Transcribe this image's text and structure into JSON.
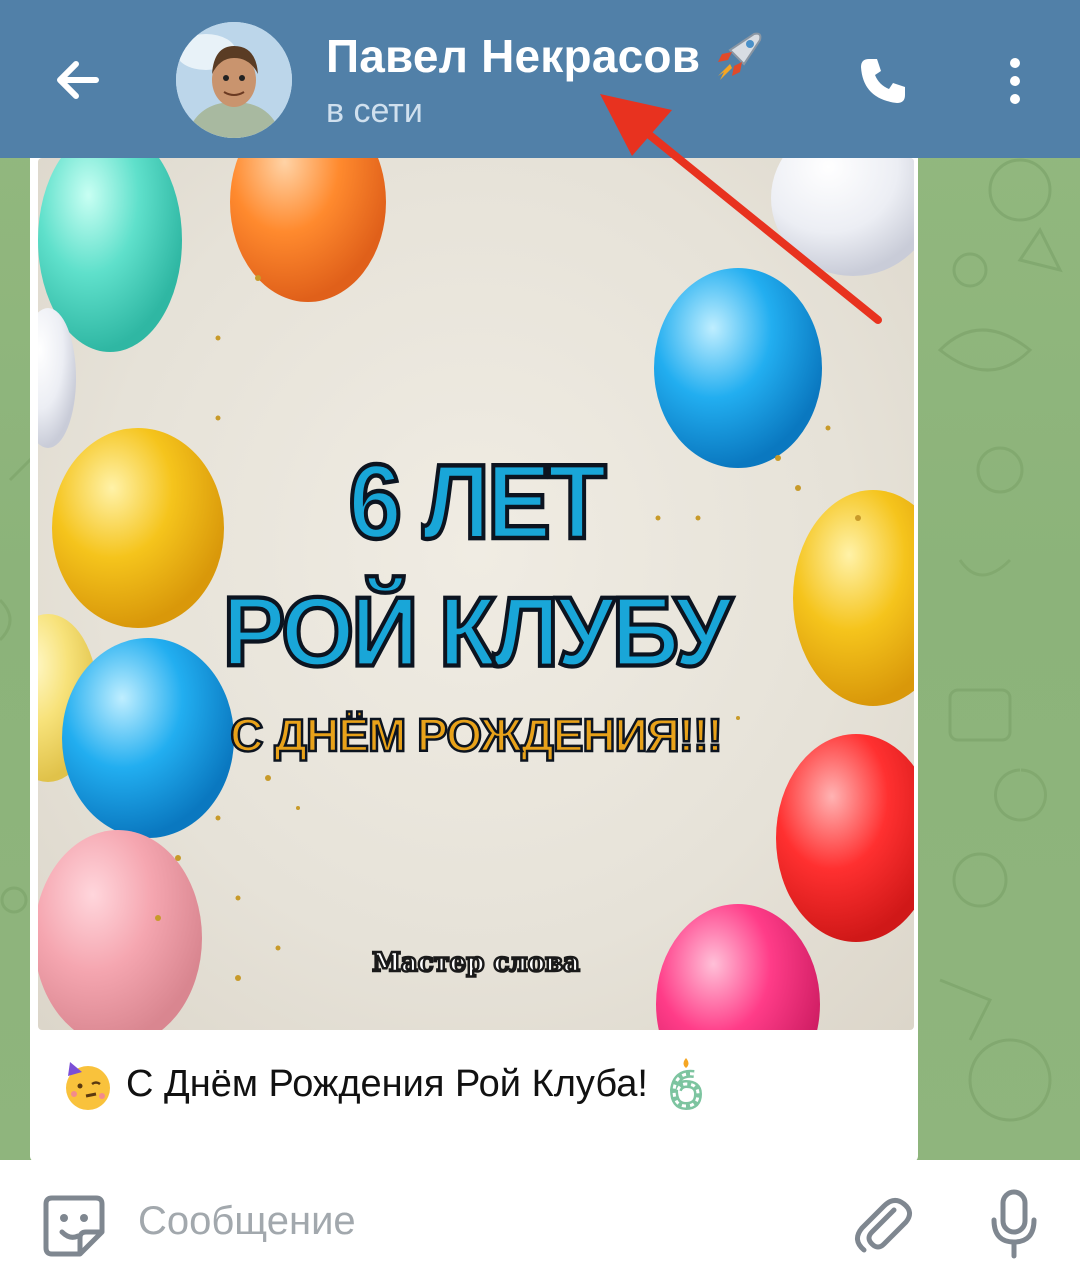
{
  "header": {
    "contact_name": "Павел Некрасов",
    "name_emoji": "rocket-emoji",
    "status": "в сети",
    "bg_color": "#5180a8",
    "icons": [
      "back-arrow-icon",
      "phone-icon",
      "more-vertical-icon"
    ]
  },
  "message": {
    "poster": {
      "line1": "6 ЛЕТ",
      "line2": "РОЙ КЛУБУ",
      "line3": "С ДНЁМ РОЖДЕНИЯ!!!",
      "signature": "Мастер слова"
    },
    "caption": "С Днём Рождения Рой Клуба!",
    "caption_emojis": [
      "party-face-emoji",
      "birthday-candle-6-emoji"
    ]
  },
  "composer": {
    "placeholder": "Сообщение",
    "icons": [
      "sticker-icon",
      "attach-icon",
      "mic-icon"
    ]
  },
  "annotation": {
    "arrow_color": "#e8321f"
  }
}
